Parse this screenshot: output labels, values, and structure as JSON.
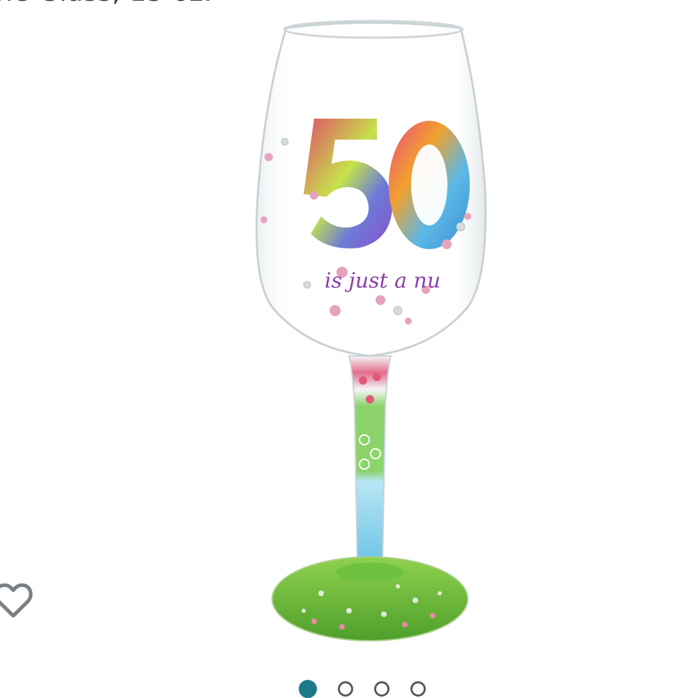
{
  "product": {
    "title_fragment": "ne Glass, 15 oz.",
    "glass_text": {
      "number": "50",
      "tagline": "is just a nu"
    }
  },
  "favorite": {
    "icon": "heart-outline-icon",
    "color": "#7a7f83"
  },
  "carousel": {
    "count": 4,
    "active_index": 0,
    "active_color": "#1b7a8a"
  }
}
